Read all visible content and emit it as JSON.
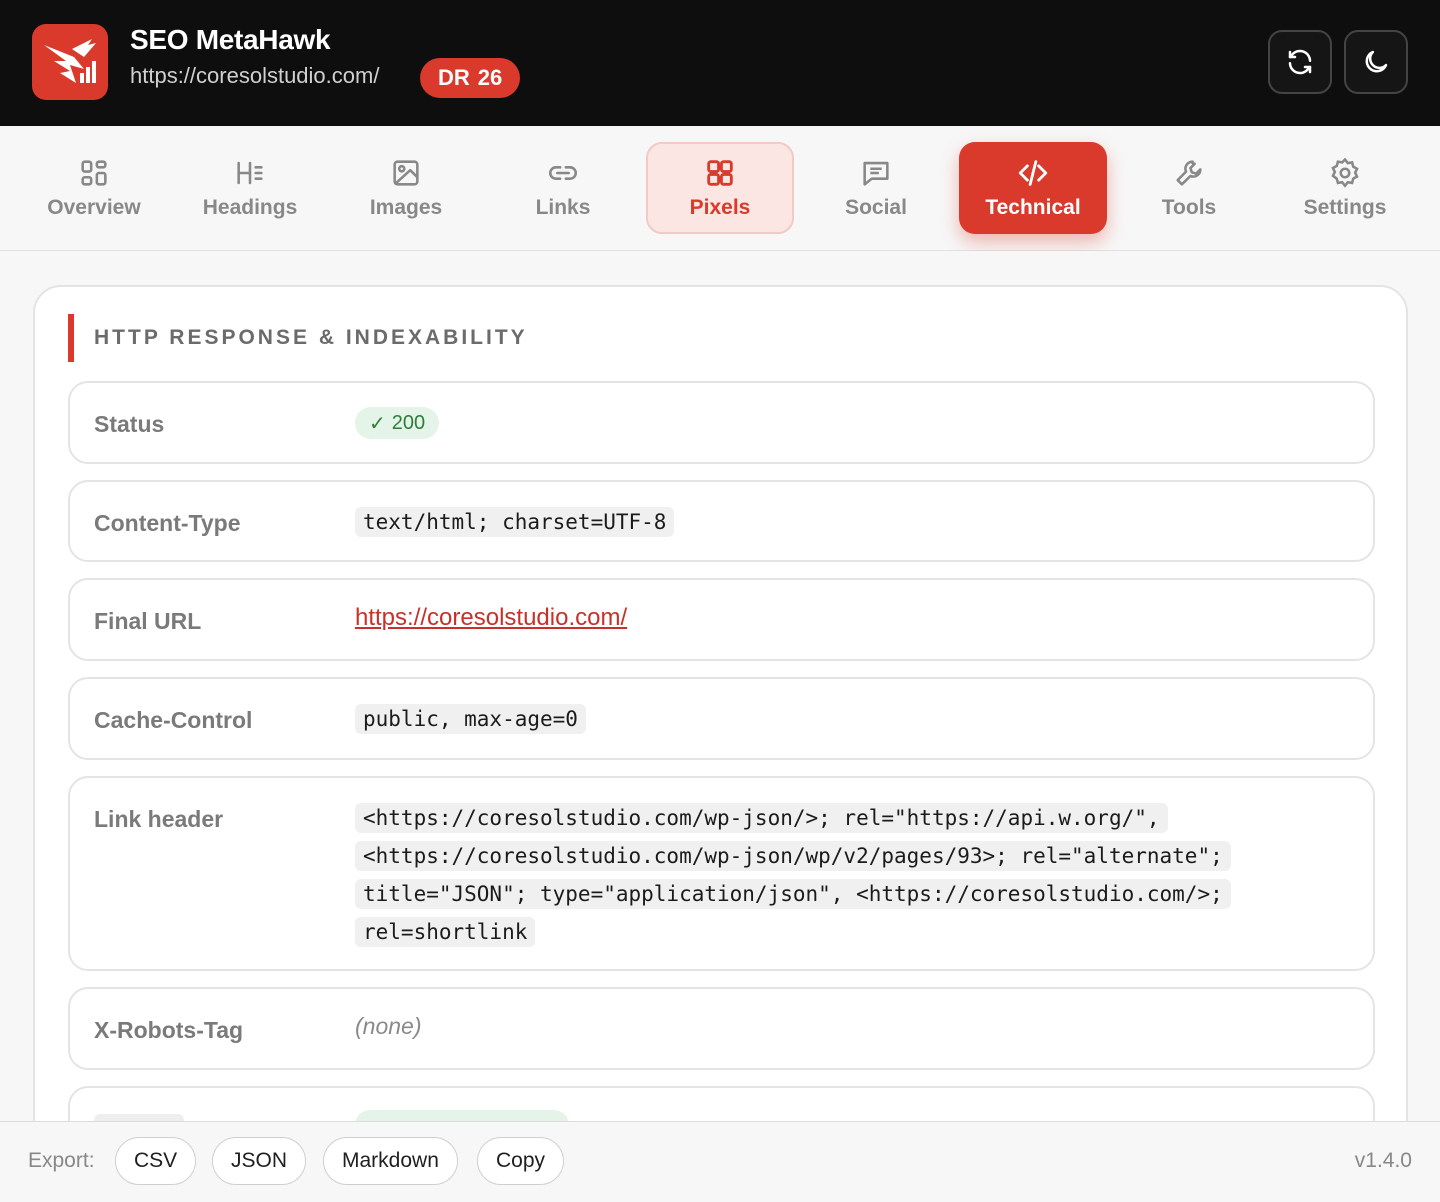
{
  "header": {
    "app_title": "SEO MetaHawk",
    "url": "https://coresolstudio.com/",
    "dr_label": "DR",
    "dr_value": "26",
    "refresh_icon": "refresh-icon",
    "theme_icon": "moon-icon"
  },
  "tabs": [
    {
      "label": "Overview",
      "icon": "grid-icon"
    },
    {
      "label": "Headings",
      "icon": "heading-icon"
    },
    {
      "label": "Images",
      "icon": "image-icon"
    },
    {
      "label": "Links",
      "icon": "link-icon"
    },
    {
      "label": "Pixels",
      "icon": "pixels-grid-icon"
    },
    {
      "label": "Social",
      "icon": "chat-icon"
    },
    {
      "label": "Technical",
      "icon": "code-icon"
    },
    {
      "label": "Tools",
      "icon": "wrench-icon"
    },
    {
      "label": "Settings",
      "icon": "gear-icon"
    }
  ],
  "active_tab": "Technical",
  "section": {
    "title": "HTTP RESPONSE & INDEXABILITY",
    "rows": [
      {
        "label": "Status",
        "value": "200",
        "check": "✓"
      },
      {
        "label": "Content-Type",
        "value": "text/html; charset=UTF-8"
      },
      {
        "label": "Final URL",
        "value": "https://coresolstudio.com/"
      },
      {
        "label": "Cache-Control",
        "value": "public, max-age=0"
      },
      {
        "label": "Link header",
        "value": "<https://coresolstudio.com/wp-json/>; rel=\"https://api.w.org/\", <https://coresolstudio.com/wp-json/wp/v2/pages/93>; rel=\"alternate\"; title=\"JSON\"; type=\"application/json\", <https://coresolstudio.com/>; rel=shortlink"
      },
      {
        "label": "X-Robots-Tag",
        "value": "(none)"
      }
    ]
  },
  "footer": {
    "export_label": "Export:",
    "buttons": [
      "CSV",
      "JSON",
      "Markdown",
      "Copy"
    ],
    "version": "v1.4.0"
  },
  "colors": {
    "accent": "#d93a2c",
    "header_bg": "#0e0e0e",
    "status_ok": "#2f7d3a"
  }
}
